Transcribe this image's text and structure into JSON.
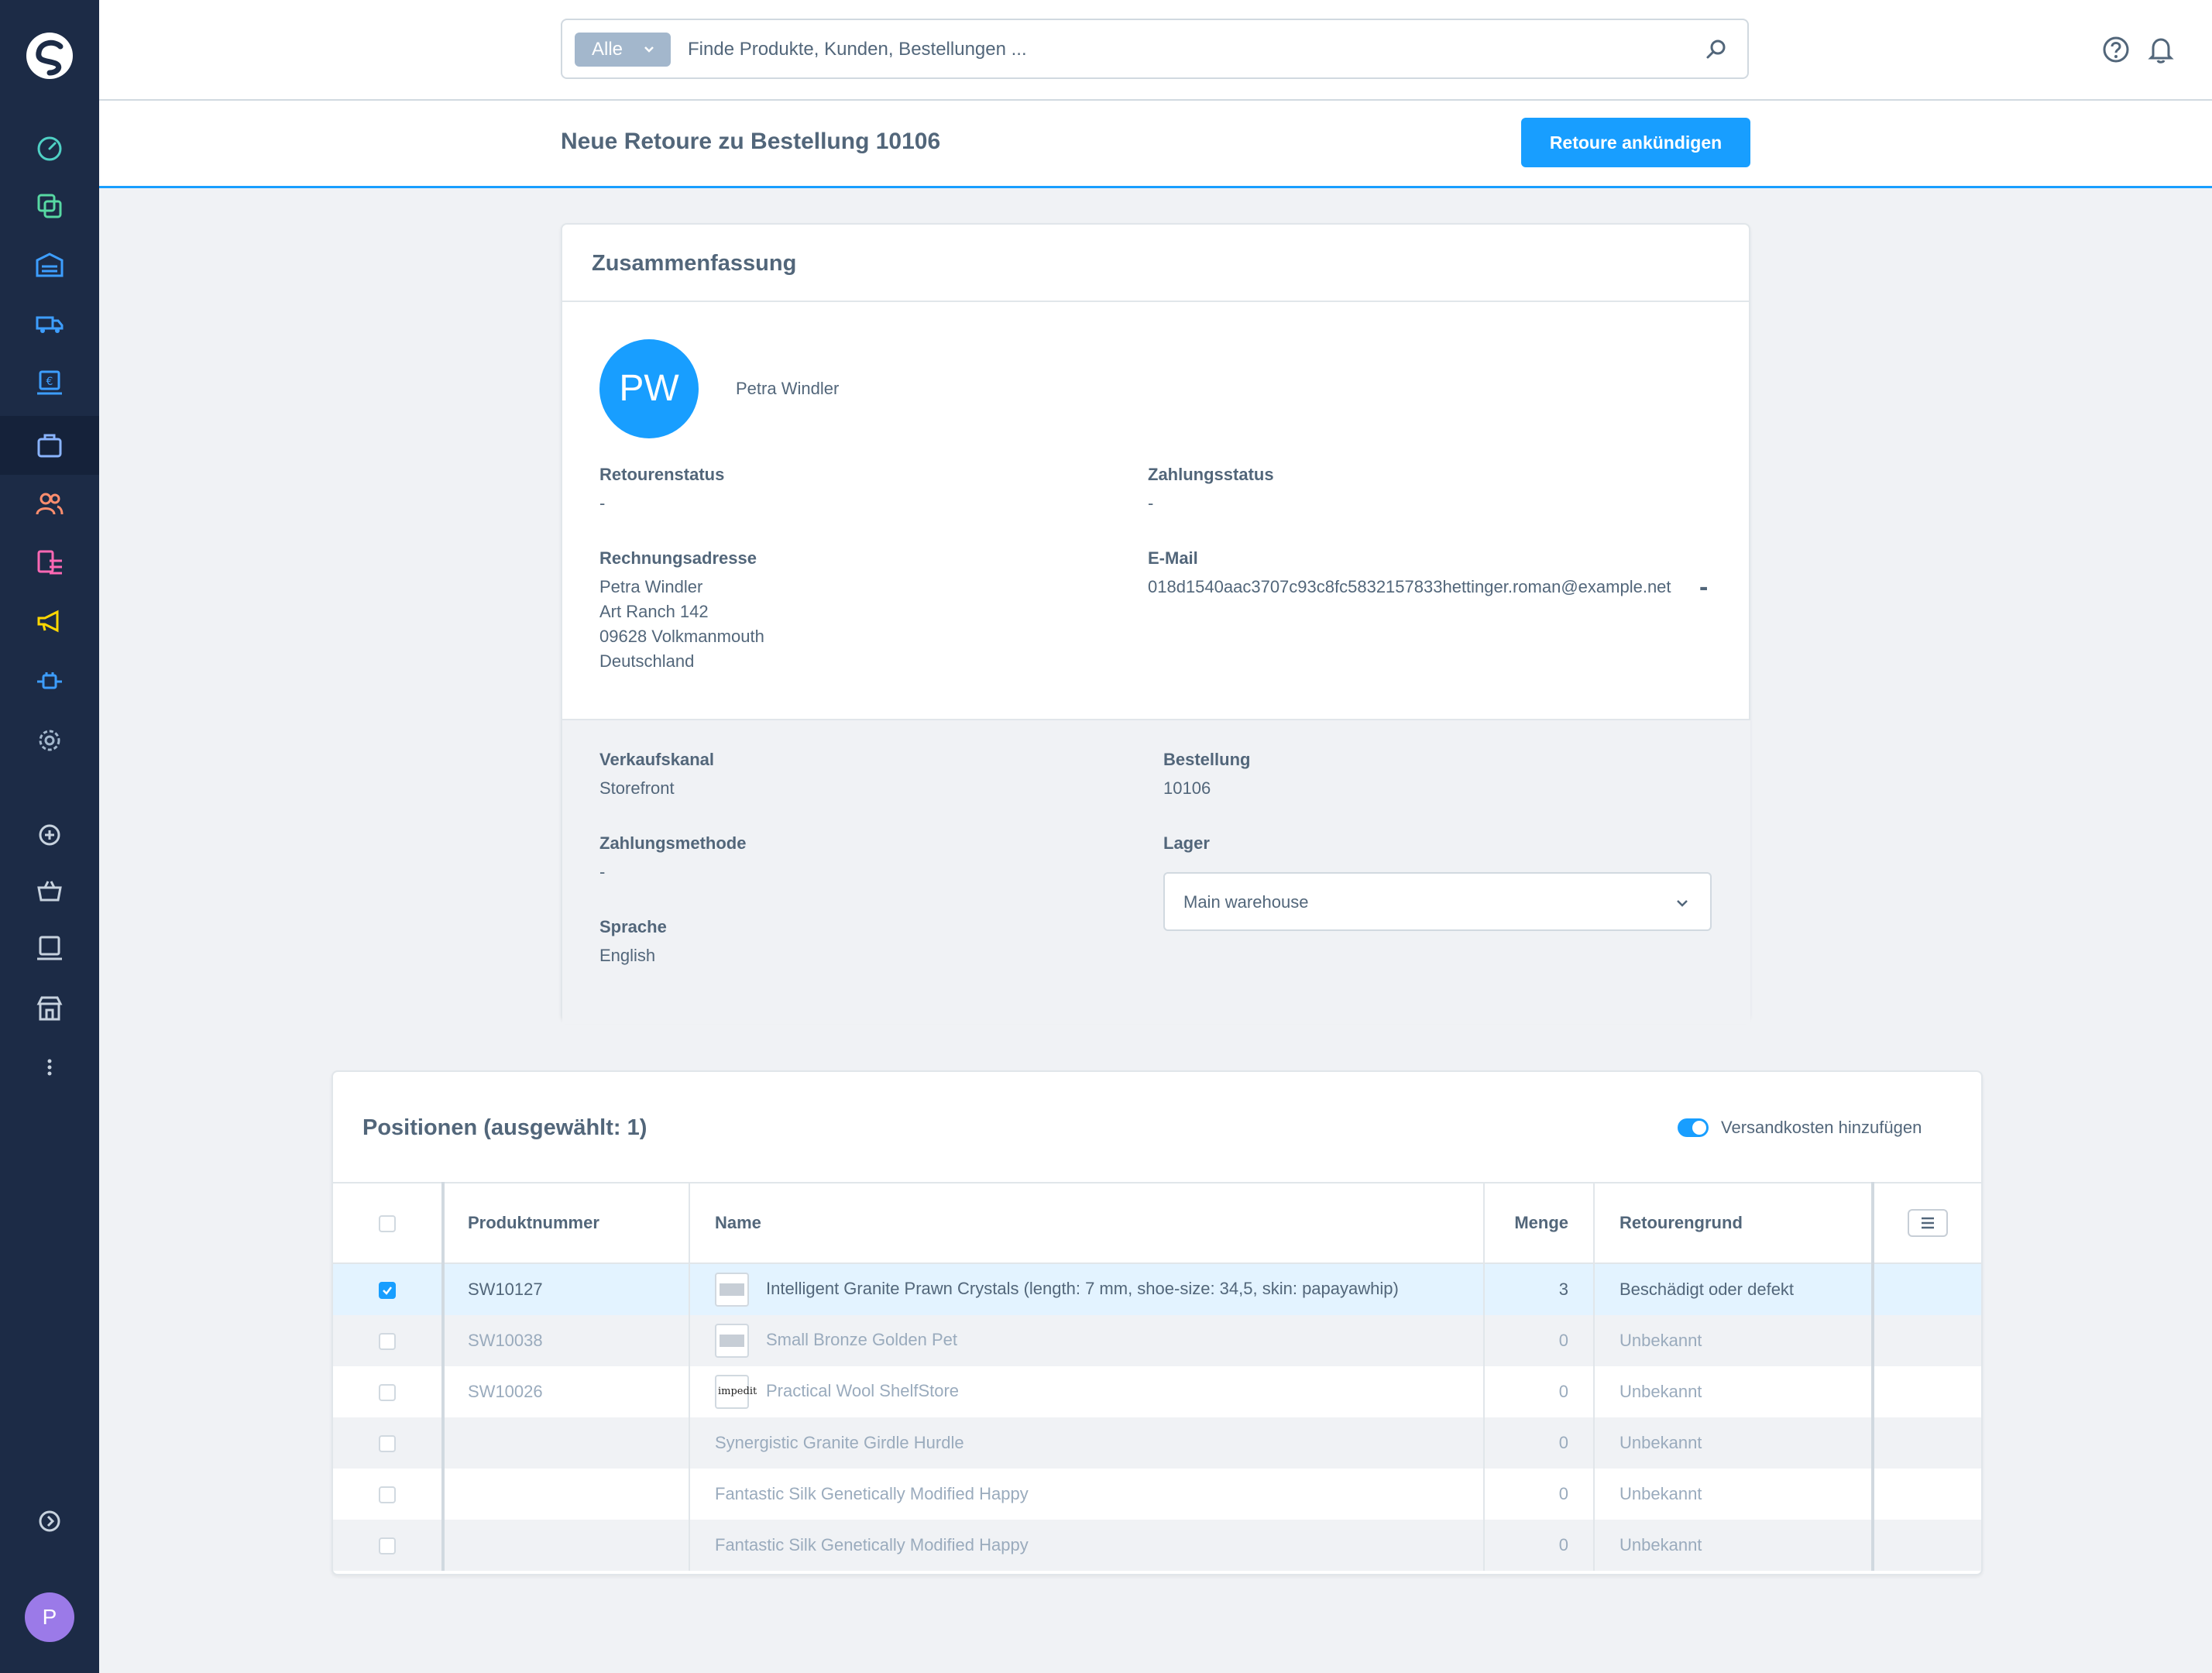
{
  "search": {
    "chip_label": "Alle",
    "placeholder": "Finde Produkte, Kunden, Bestellungen ..."
  },
  "header": {
    "title": "Neue Retoure zu Bestellung 10106",
    "primary_button": "Retoure ankündigen"
  },
  "sidebar": {
    "user_initial": "P"
  },
  "summary": {
    "title": "Zusammenfassung",
    "customer_initials": "PW",
    "customer_name": "Petra Windler",
    "dash": "-",
    "return_status_label": "Retourenstatus",
    "return_status_value": "-",
    "payment_status_label": "Zahlungsstatus",
    "payment_status_value": "-",
    "billing_label": "Rechnungsadresse",
    "billing_lines": [
      "Petra Windler",
      "Art Ranch 142",
      "09628 Volkmanmouth",
      "Deutschland"
    ],
    "email_label": "E-Mail",
    "email_value": "018d1540aac3707c93c8fc5832157833hettinger.roman@example.net",
    "sales_channel_label": "Verkaufskanal",
    "sales_channel_value": "Storefront",
    "order_label": "Bestellung",
    "order_value": "10106",
    "payment_method_label": "Zahlungsmethode",
    "payment_method_value": "-",
    "warehouse_label": "Lager",
    "warehouse_value": "Main warehouse",
    "language_label": "Sprache",
    "language_value": "English"
  },
  "positions": {
    "title": "Positionen (ausgewählt: 1)",
    "toggle_label": "Versandkosten hinzufügen",
    "columns": [
      "Produktnummer",
      "Name",
      "Menge",
      "Retourengrund"
    ],
    "rows": [
      {
        "number": "SW10127",
        "thumb": "recusandae",
        "name": "Intelligent Granite Prawn Crystals (length: 7 mm, shoe-size: 34,5, skin: papayawhip)",
        "qty": "3",
        "reason": "Beschädigt oder defekt"
      },
      {
        "number": "SW10038",
        "thumb": "aspernatur",
        "name": "Small Bronze Golden Pet",
        "qty": "0",
        "reason": "Unbekannt"
      },
      {
        "number": "SW10026",
        "thumb": "impedit",
        "name": "Practical Wool ShelfStore",
        "qty": "0",
        "reason": "Unbekannt"
      },
      {
        "number": "",
        "thumb": "",
        "name": "Synergistic Granite Girdle Hurdle",
        "qty": "0",
        "reason": "Unbekannt"
      },
      {
        "number": "",
        "thumb": "",
        "name": "Fantastic Silk Genetically Modified Happy",
        "qty": "0",
        "reason": "Unbekannt"
      },
      {
        "number": "",
        "thumb": "",
        "name": "Fantastic Silk Genetically Modified Happy",
        "qty": "0",
        "reason": "Unbekannt"
      }
    ]
  },
  "colors": {
    "accent": "#189eff",
    "sidebar": "#1c2b46"
  }
}
